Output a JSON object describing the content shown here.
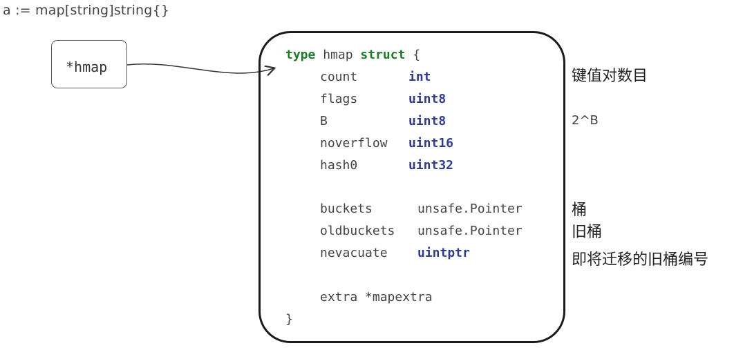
{
  "declaration": "a := map[string]string{}",
  "pointer_label": "*hmap",
  "struct_header": {
    "keyword": "type",
    "name": "hmap",
    "struct_keyword": "struct",
    "brace_open": "{"
  },
  "fields": [
    {
      "name": "count",
      "type": "int"
    },
    {
      "name": "flags",
      "type": "uint8"
    },
    {
      "name": "B",
      "type": "uint8"
    },
    {
      "name": "noverflow",
      "type": "uint16"
    },
    {
      "name": "hash0",
      "type": "uint32"
    },
    {
      "name": "buckets",
      "type": "unsafe.Pointer"
    },
    {
      "name": "oldbuckets",
      "type": "unsafe.Pointer"
    },
    {
      "name": "nevacuate",
      "type": "uintptr"
    },
    {
      "name": "extra",
      "type": "*mapextra"
    }
  ],
  "brace_close": "}",
  "annotations": {
    "count": "键值对数目",
    "B": "2^B",
    "buckets": "桶",
    "oldbuckets": "旧桶",
    "nevacuate": "即将迁移的旧桶编号"
  },
  "colors": {
    "keyword": "#1f7a2a",
    "type": "#2f3d8c",
    "border": "#1a1a1a"
  }
}
